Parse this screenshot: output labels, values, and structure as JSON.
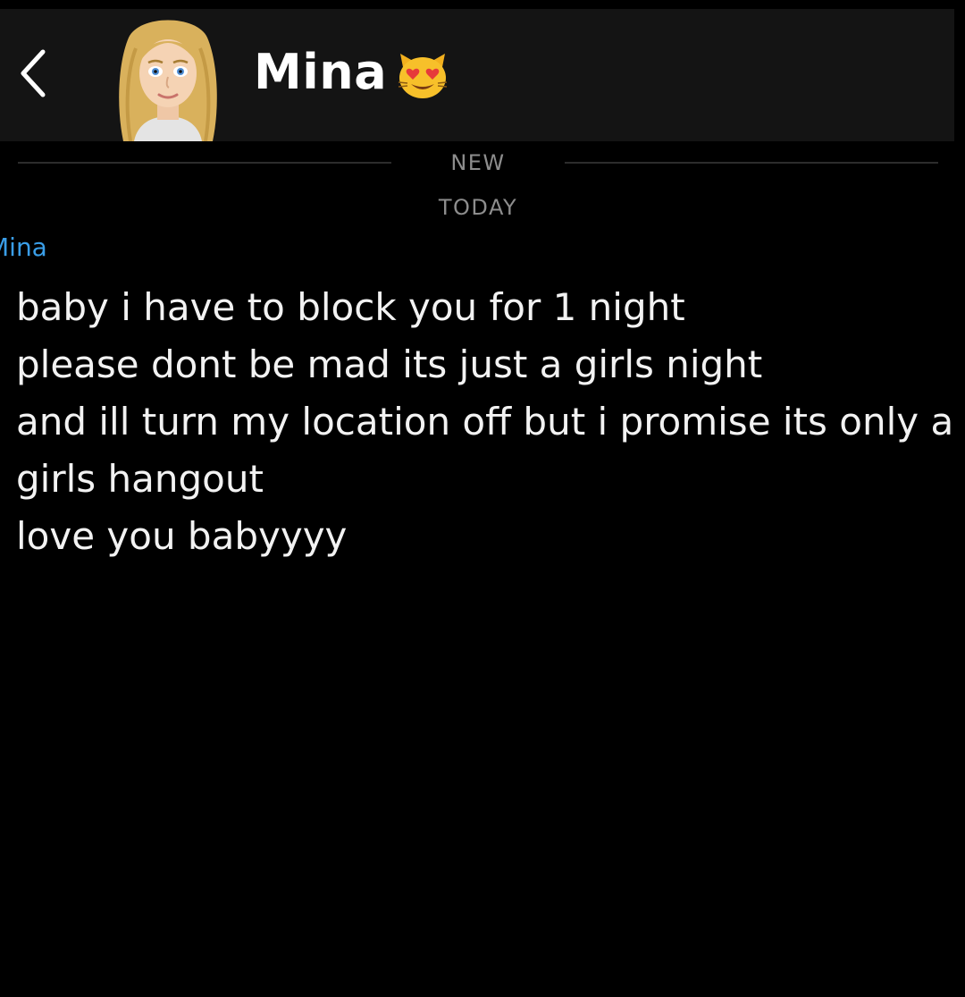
{
  "header": {
    "contact_name": "Mina",
    "back_icon": "chevron-left-icon",
    "avatar_icon": "bitmoji-avatar",
    "status_emoji": "smiling-cat-heart-eyes-icon"
  },
  "chat": {
    "new_label": "NEW",
    "date_label": "TODAY",
    "sender": "Mina",
    "sender_color": "#3a9ee8",
    "messages": [
      "baby i have to block you for 1 night",
      "please dont be mad its just a girls night",
      "and ill turn my location off but i promise its only a girls hangout",
      "love you babyyyy"
    ]
  }
}
